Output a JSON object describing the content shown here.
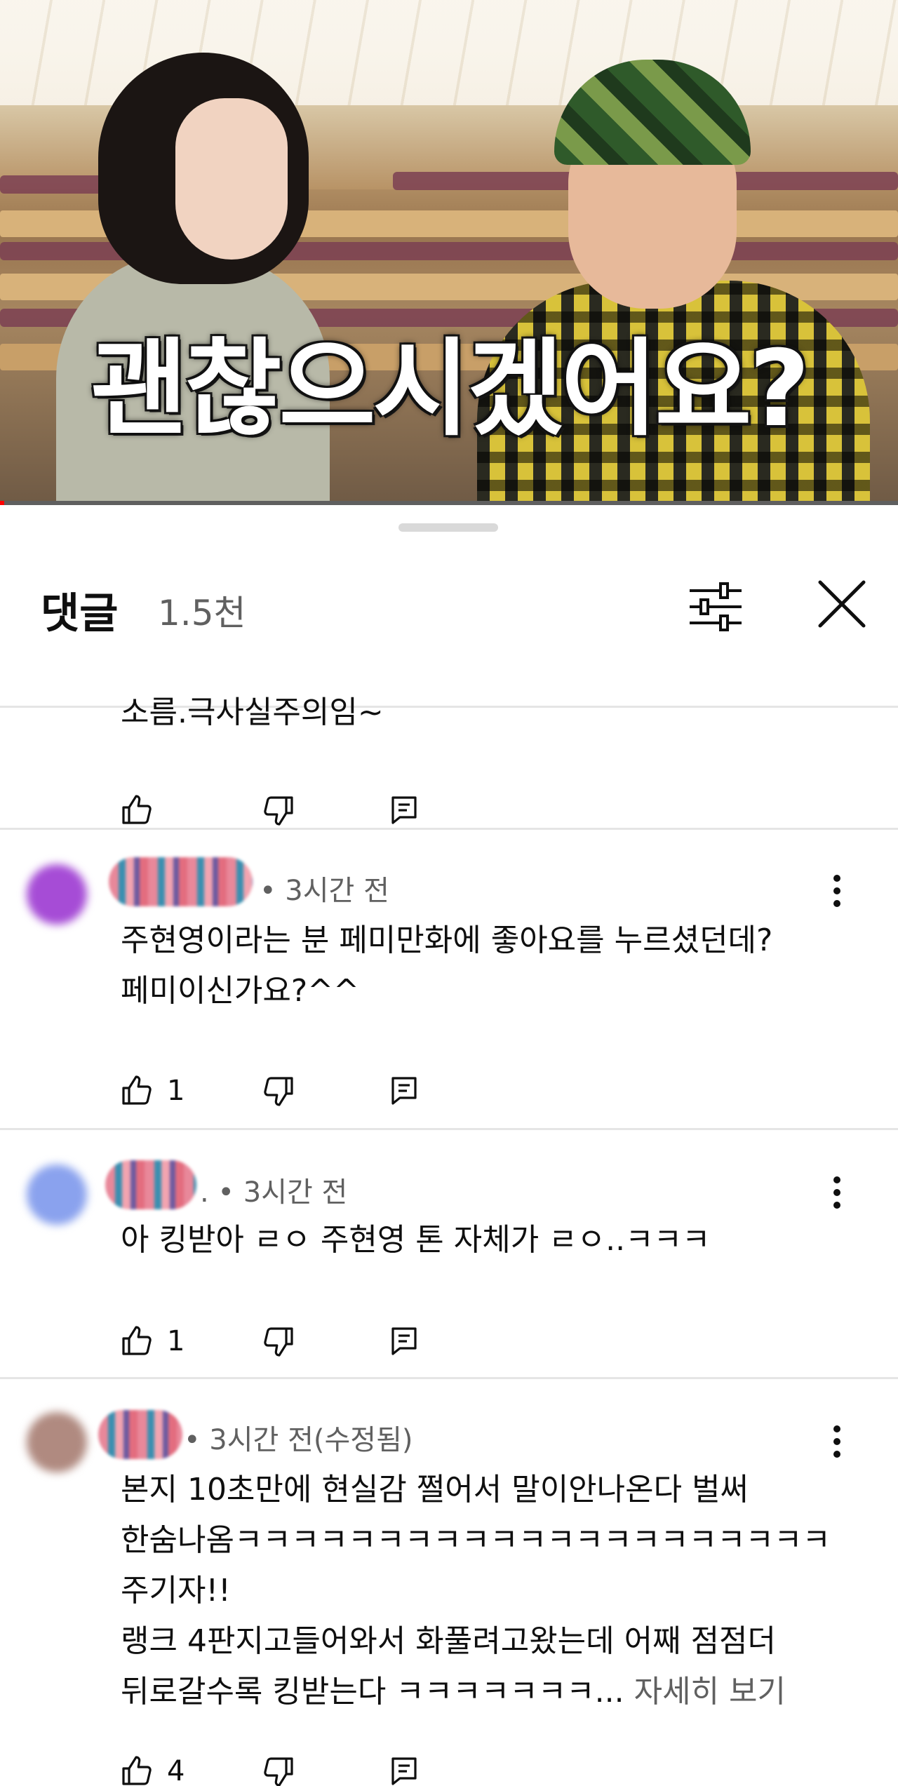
{
  "video": {
    "overlay_title": "괜찮으시겠어요?",
    "progress_fraction": 0.005
  },
  "comments_panel": {
    "title": "댓글",
    "count": "1.5천",
    "filter_icon": "sliders-icon",
    "close_icon": "close-icon"
  },
  "comments": [
    {
      "text_lines": [
        "소름.극사실주의임~"
      ],
      "likes": ""
    },
    {
      "avatar_color": "#a64cd6",
      "meta": "• 3시간 전",
      "text_lines": [
        "주현영이라는 분 페미만화에 좋아요를 누르셨던데?",
        "페미이신가요?^^"
      ],
      "likes": "1"
    },
    {
      "avatar_color": "#8aa2ee",
      "meta": ". • 3시간 전",
      "text_lines": [
        "아 킹받아 ㄹㅇ  주현영 톤 자체가 ㄹㅇ..ㅋㅋㅋ"
      ],
      "likes": "1"
    },
    {
      "avatar_color": "#b08a80",
      "meta": "• 3시간 전(수정됨)",
      "text_lines": [
        "본지 10초만에 현실감 쩔어서 말이안나온다 벌써",
        "한숨나옴ㅋㅋㅋㅋㅋㅋㅋㅋㅋㅋㅋㅋㅋㅋㅋㅋㅋㅋㅋㅋㅋ",
        "주기자!!",
        "랭크 4판지고들어와서 화풀려고왔는데 어째 점점더",
        "뒤로갈수록 킹받는다 ㅋㅋㅋㅋㅋㅋㅋ..."
      ],
      "read_more": "자세히 보기",
      "likes": "4"
    }
  ],
  "icons": {
    "like": "thumb-up-icon",
    "dislike": "thumb-down-icon",
    "reply": "reply-icon",
    "more": "more-vert-icon"
  }
}
